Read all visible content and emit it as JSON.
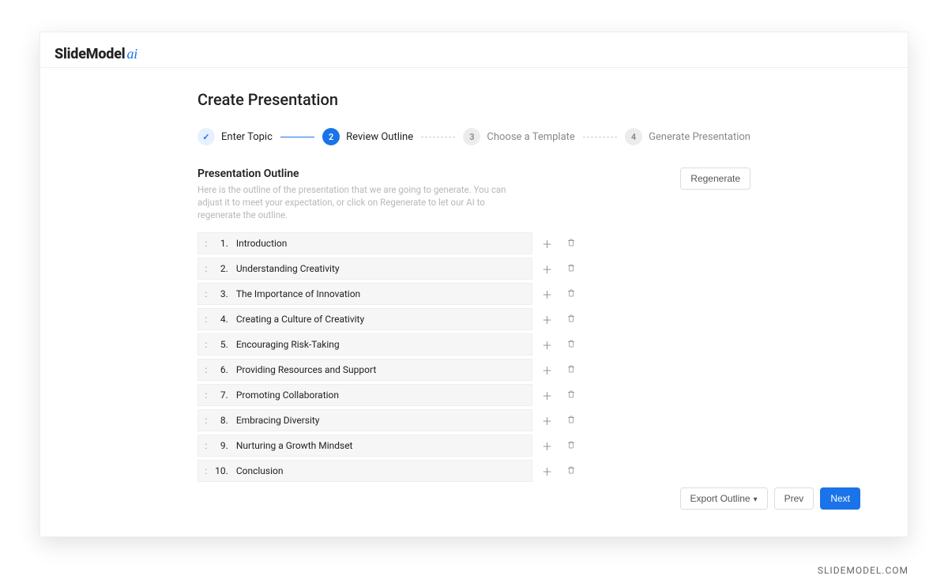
{
  "brand": {
    "name": "SlideModel",
    "suffix": "ai"
  },
  "page_title": "Create Presentation",
  "stepper": {
    "steps": [
      {
        "label": "Enter Topic",
        "state": "done"
      },
      {
        "label": "Review Outline",
        "number": "2",
        "state": "active"
      },
      {
        "label": "Choose a Template",
        "number": "3",
        "state": "pending"
      },
      {
        "label": "Generate Presentation",
        "number": "4",
        "state": "pending"
      }
    ]
  },
  "outline": {
    "title": "Presentation Outline",
    "description": "Here is the outline of the presentation that we are going to generate.\nYou can adjust it to meet your expectation, or click on Regenerate to let our AI to regenerate the outline.",
    "regenerate_label": "Regenerate",
    "items": [
      {
        "n": "1.",
        "title": "Introduction"
      },
      {
        "n": "2.",
        "title": "Understanding Creativity"
      },
      {
        "n": "3.",
        "title": "The Importance of Innovation"
      },
      {
        "n": "4.",
        "title": "Creating a Culture of Creativity"
      },
      {
        "n": "5.",
        "title": "Encouraging Risk-Taking"
      },
      {
        "n": "6.",
        "title": "Providing Resources and Support"
      },
      {
        "n": "7.",
        "title": "Promoting Collaboration"
      },
      {
        "n": "8.",
        "title": "Embracing Diversity"
      },
      {
        "n": "9.",
        "title": "Nurturing a Growth Mindset"
      },
      {
        "n": "10.",
        "title": "Conclusion"
      }
    ]
  },
  "footer": {
    "export_label": "Export Outline",
    "prev_label": "Prev",
    "next_label": "Next"
  },
  "watermark": "SLIDEMODEL.COM",
  "icons": {
    "check": "✓",
    "plus": "＋"
  }
}
